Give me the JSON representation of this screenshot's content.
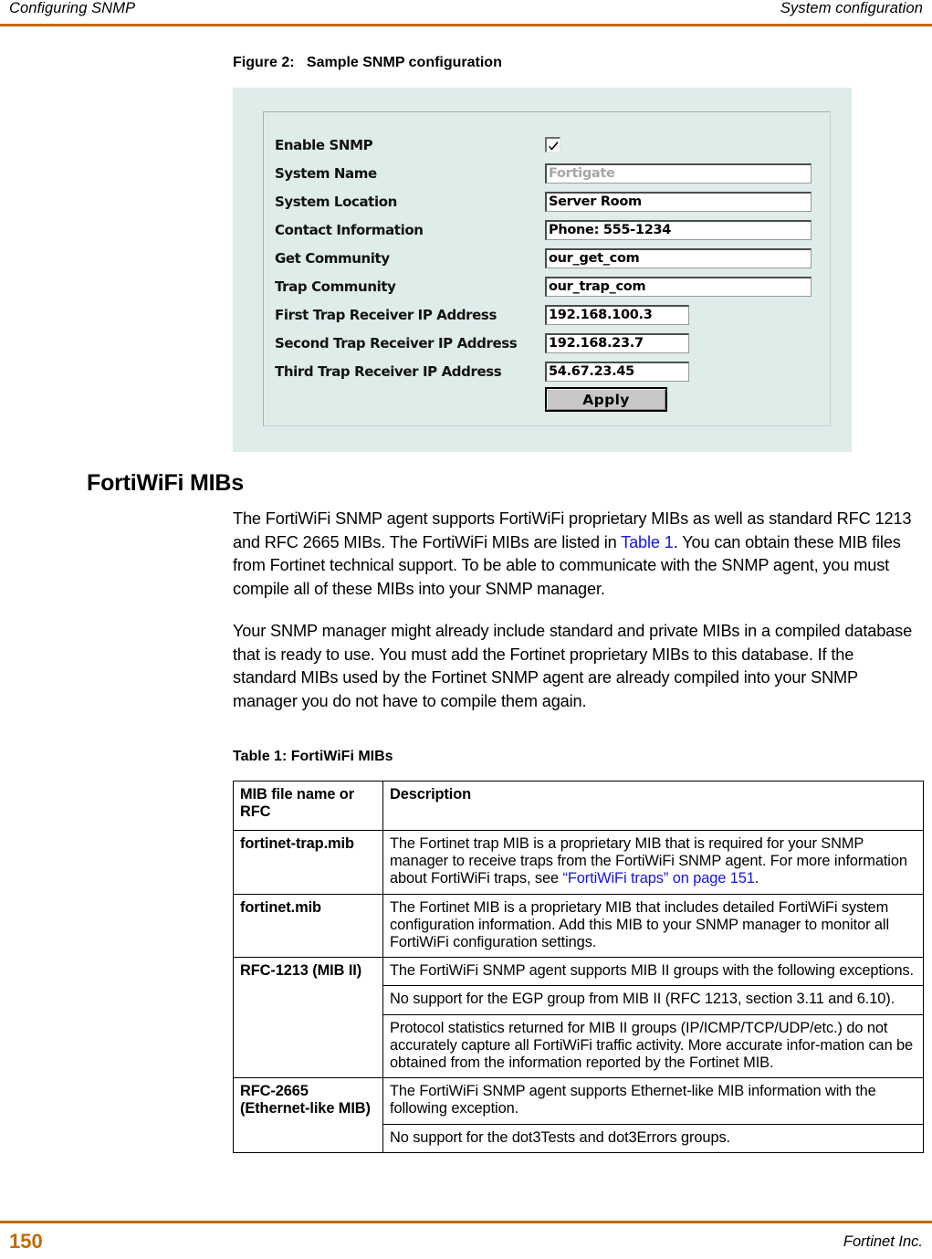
{
  "header": {
    "left": "Configuring SNMP",
    "right": "System configuration",
    "rule_color": "#c06a06"
  },
  "figure": {
    "caption": "Figure 2:   Sample SNMP configuration",
    "panel_color": "#deecea",
    "form": {
      "rows": [
        {
          "label": "Enable SNMP",
          "type": "checkbox",
          "checked": true
        },
        {
          "label": "System Name",
          "type": "text",
          "value": "Fortigate",
          "width": "wide",
          "disabled": true
        },
        {
          "label": "System Location",
          "type": "text",
          "value": "Server Room",
          "width": "wide",
          "disabled": false
        },
        {
          "label": "Contact Information",
          "type": "text",
          "value": "Phone: 555-1234",
          "width": "wide",
          "disabled": false
        },
        {
          "label": "Get Community",
          "type": "text",
          "value": "our_get_com",
          "width": "wide",
          "disabled": false
        },
        {
          "label": "Trap Community",
          "type": "text",
          "value": "our_trap_com",
          "width": "wide",
          "disabled": false
        },
        {
          "label": "First Trap Receiver IP Address",
          "type": "text",
          "value": "192.168.100.3",
          "width": "narrow",
          "disabled": false
        },
        {
          "label": "Second Trap Receiver IP Address",
          "type": "text",
          "value": "192.168.23.7",
          "width": "narrow",
          "disabled": false
        },
        {
          "label": "Third Trap Receiver IP Address",
          "type": "text",
          "value": "54.67.23.45",
          "width": "narrow",
          "disabled": false
        }
      ],
      "apply_label": "Apply"
    }
  },
  "section": {
    "heading": "FortiWiFi MIBs",
    "paragraph_1_part_1": "The FortiWiFi SNMP agent supports FortiWiFi proprietary MIBs as well as standard RFC 1213 and RFC 2665 MIBs. The FortiWiFi MIBs are listed in ",
    "paragraph_1_link": "Table 1",
    "paragraph_1_part_2": ". You can obtain these MIB files from Fortinet technical support. To be able to communicate with the SNMP agent, you must compile all of these MIBs into your SNMP manager.",
    "paragraph_2": "Your SNMP manager might already include standard and private MIBs in a compiled database that is ready to use. You must add the Fortinet proprietary MIBs to this database. If the standard MIBs used by the Fortinet SNMP agent are already compiled into your SNMP manager you do not have to compile them again."
  },
  "table": {
    "caption": "Table 1: FortiWiFi MIBs",
    "headers": {
      "col1": "MIB file name or RFC",
      "col2": "Description"
    },
    "rows": [
      {
        "key": "fortinet-trap.mib",
        "desc_part_1": "The Fortinet trap MIB is a proprietary MIB that is required for your SNMP manager to receive traps from the FortiWiFi SNMP agent. For more information about FortiWiFi traps, see ",
        "desc_link": "“FortiWiFi traps” on page 151",
        "desc_part_2": "."
      },
      {
        "key": "fortinet.mib",
        "desc": "The Fortinet MIB is a proprietary MIB that includes detailed FortiWiFi system configuration information. Add this MIB to your SNMP manager to monitor all FortiWiFi configuration settings."
      },
      {
        "key": "RFC-1213 (MIB II)",
        "desc_a": "The FortiWiFi SNMP agent supports MIB II groups with the following exceptions.",
        "desc_b": "No support for the EGP group from MIB II (RFC 1213, section 3.11 and 6.10).",
        "desc_c": "Protocol statistics returned for MIB II groups (IP/ICMP/TCP/UDP/etc.) do not accurately capture all FortiWiFi traffic activity. More accurate infor-mation can be obtained from the information reported by the Fortinet MIB."
      },
      {
        "key": "RFC-2665 (Ethernet-like MIB)",
        "desc_a": "The FortiWiFi SNMP agent supports Ethernet-like MIB information with the following exception.",
        "desc_b": "No support for the dot3Tests and dot3Errors groups."
      }
    ]
  },
  "footer": {
    "page_number": "150",
    "organization": "Fortinet Inc."
  }
}
